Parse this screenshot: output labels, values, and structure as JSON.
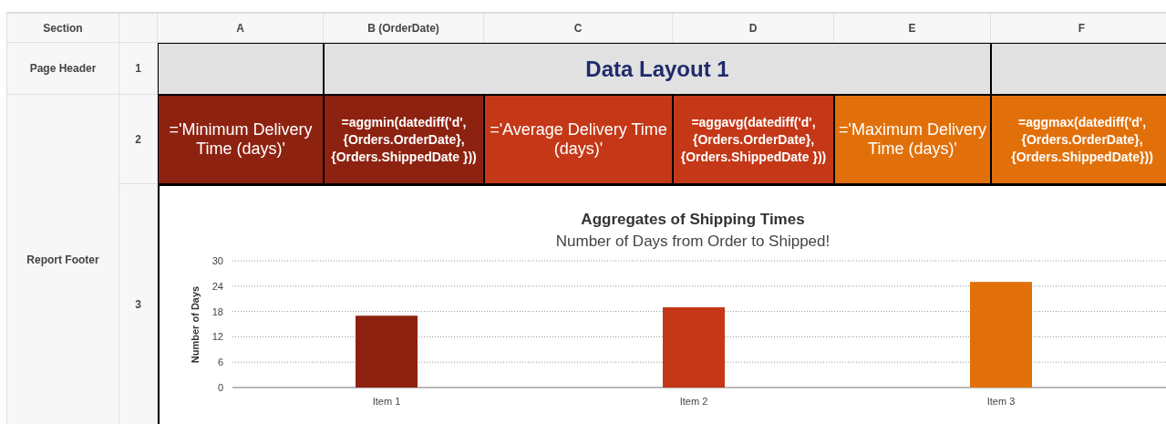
{
  "columns": [
    {
      "label": "Section"
    },
    {
      "label": "A"
    },
    {
      "label": "B (OrderDate)"
    },
    {
      "label": "C"
    },
    {
      "label": "D"
    },
    {
      "label": "E"
    },
    {
      "label": "F"
    }
  ],
  "sections": [
    {
      "label": "Page Header"
    },
    {
      "label": "Report Footer"
    }
  ],
  "rows": [
    {
      "number": "1",
      "title": "Data Layout 1"
    },
    {
      "number": "2",
      "cells": [
        {
          "kind": "label",
          "text": "='Minimum Delivery Time (days)'",
          "color": "#8e2210"
        },
        {
          "kind": "formula",
          "text": "=aggmin(datediff('d', {Orders.OrderDate}, {Orders.ShippedDate }))",
          "color": "#8e2210"
        },
        {
          "kind": "label",
          "text": "='Average Delivery Time (days)'",
          "color": "#c43817"
        },
        {
          "kind": "formula",
          "text": "=aggavg(datediff('d', {Orders.OrderDate}, {Orders.ShippedDate }))",
          "color": "#c43817"
        },
        {
          "kind": "label",
          "text": "='Maximum Delivery Time (days)'",
          "color": "#e2700a"
        },
        {
          "kind": "formula",
          "text": "=aggmax(datediff('d', {Orders.OrderDate}, {Orders.ShippedDate}))",
          "color": "#e2700a"
        }
      ]
    },
    {
      "number": "3",
      "chart_data": {
        "type": "bar",
        "title": "Aggregates of Shipping Times",
        "subtitle": "Number of Days from Order to Shipped!",
        "ylabel": "Number of Days",
        "categories": [
          "Item 1",
          "Item 2",
          "Item 3"
        ],
        "series": [
          {
            "color": "#8e2210",
            "values": [
              17,
              null,
              null
            ]
          },
          {
            "color": "#c43817",
            "values": [
              null,
              19,
              null
            ]
          },
          {
            "color": "#e2700a",
            "values": [
              null,
              null,
              25
            ]
          }
        ],
        "grid": true,
        "ylim": [
          0,
          30
        ],
        "yticks": [
          0,
          6,
          12,
          18,
          24,
          30
        ]
      }
    }
  ]
}
